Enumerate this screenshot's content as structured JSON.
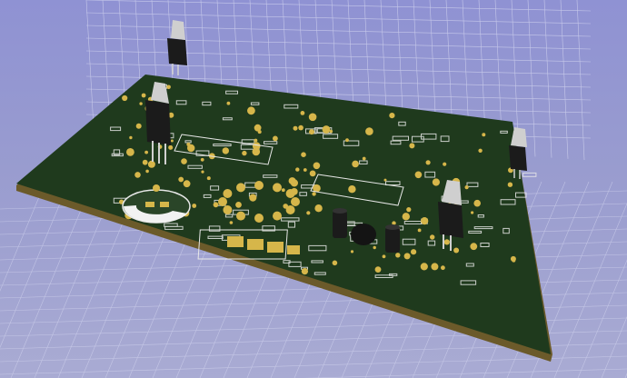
{
  "scene": {
    "background_top": "#8f92d3",
    "background_bottom": "#a9abd3",
    "grid_color": "#d8daf2",
    "board_color": "#1f3a1d",
    "board_edge_color": "#6b5a2a",
    "pad_color": "#d6b64a",
    "silk_color": "#e8e8e8"
  },
  "viewer": {
    "type": "3d-pcb-viewer",
    "icons": {
      "board": "pcb-board-icon",
      "regulator": "to220-regulator-icon",
      "capacitor": "electrolytic-capacitor-icon",
      "crystal": "crystal-icon",
      "ic": "dip-ic-icon"
    }
  }
}
